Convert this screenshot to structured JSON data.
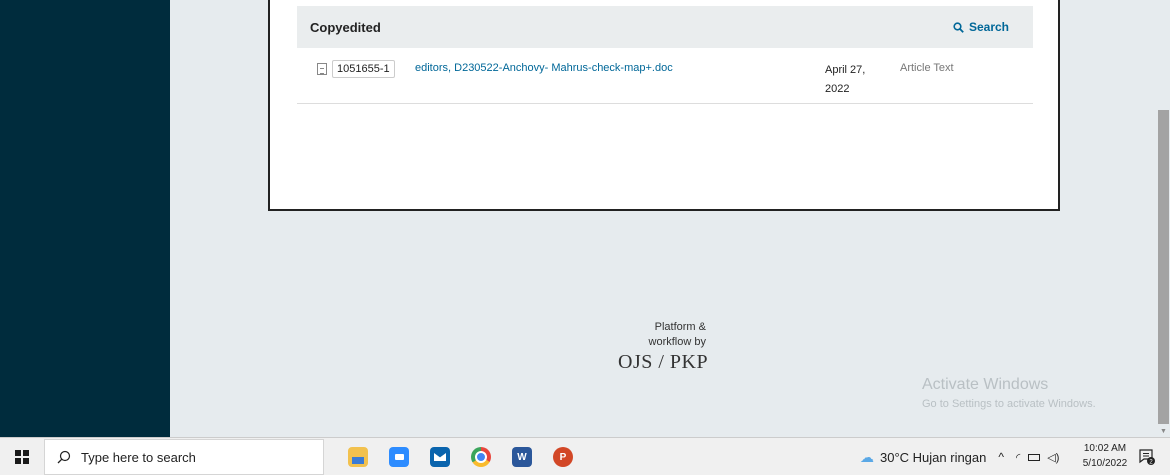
{
  "grid": {
    "title": "Copyedited",
    "search_label": "Search",
    "rows": [
      {
        "id": "1051655-1",
        "name": "editors, D230522-Anchovy- Mahrus-check-map+.doc",
        "date": "April 27, 2022",
        "type": "Article Text"
      }
    ]
  },
  "footer": {
    "line1": "Platform &",
    "line2": "workflow by",
    "brand": "OJS / PKP"
  },
  "watermark": {
    "title": "Activate Windows",
    "subtitle": "Go to Settings to activate Windows."
  },
  "taskbar": {
    "search_placeholder": "Type here to search",
    "apps": [
      {
        "icon": "file-explorer-icon",
        "color": "#f2c14e",
        "letter": ""
      },
      {
        "icon": "zoom-icon",
        "color": "#2d8cff",
        "letter": ""
      },
      {
        "icon": "mail-icon",
        "color": "#0a64ad",
        "letter": ""
      },
      {
        "icon": "chrome-icon",
        "color": "#e8453c",
        "letter": ""
      },
      {
        "icon": "word-icon",
        "color": "#2b579a",
        "letter": "W"
      },
      {
        "icon": "powerpoint-icon",
        "color": "#d24726",
        "letter": "P"
      }
    ],
    "weather": "30°C  Hujan ringan",
    "time": "10:02 AM",
    "date": "5/10/2022",
    "notification_count": "2"
  }
}
